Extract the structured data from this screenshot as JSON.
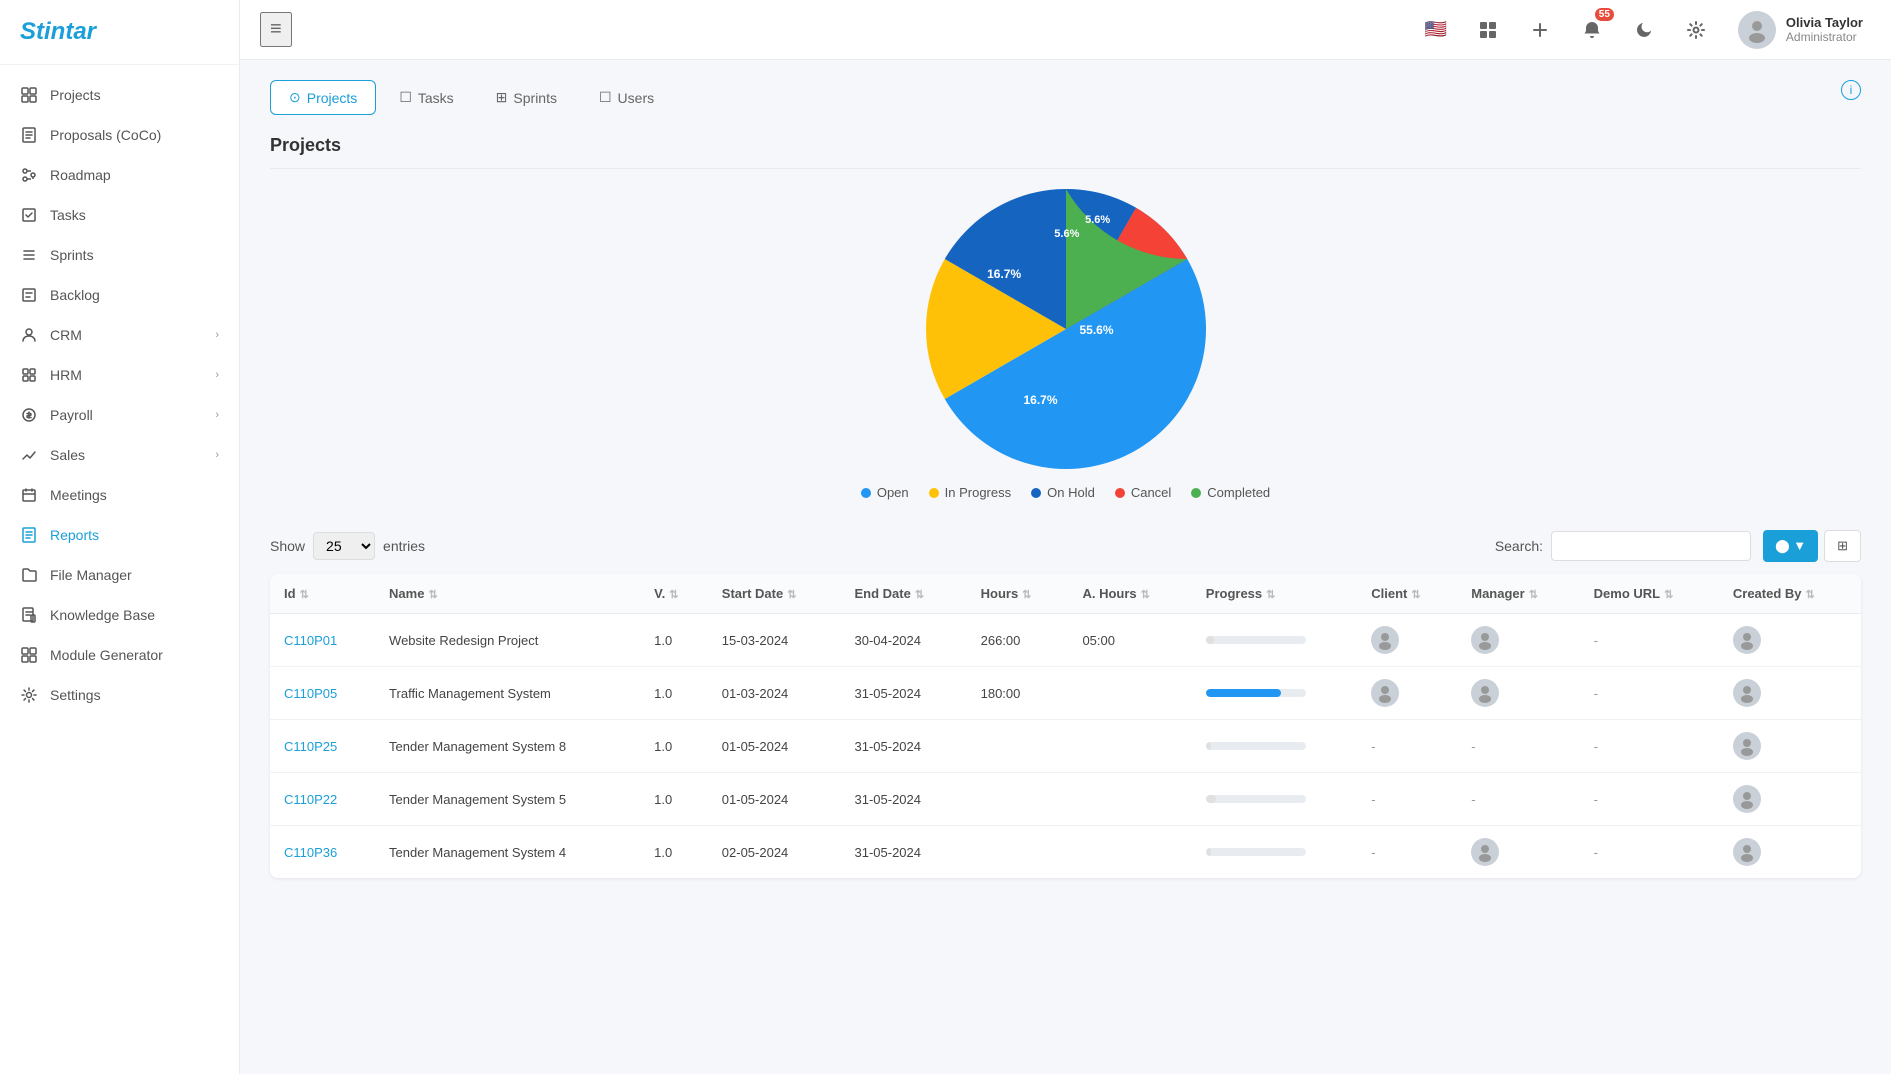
{
  "app": {
    "name": "Stintar"
  },
  "sidebar": {
    "items": [
      {
        "id": "projects",
        "label": "Projects",
        "icon": "folder-icon"
      },
      {
        "id": "proposals",
        "label": "Proposals (CoCo)",
        "icon": "document-icon"
      },
      {
        "id": "roadmap",
        "label": "Roadmap",
        "icon": "roadmap-icon"
      },
      {
        "id": "tasks",
        "label": "Tasks",
        "icon": "task-icon"
      },
      {
        "id": "sprints",
        "label": "Sprints",
        "icon": "sprints-icon"
      },
      {
        "id": "backlog",
        "label": "Backlog",
        "icon": "backlog-icon"
      },
      {
        "id": "crm",
        "label": "CRM",
        "icon": "crm-icon",
        "hasChildren": true
      },
      {
        "id": "hrm",
        "label": "HRM",
        "icon": "hrm-icon",
        "hasChildren": true
      },
      {
        "id": "payroll",
        "label": "Payroll",
        "icon": "payroll-icon",
        "hasChildren": true
      },
      {
        "id": "sales",
        "label": "Sales",
        "icon": "sales-icon",
        "hasChildren": true
      },
      {
        "id": "meetings",
        "label": "Meetings",
        "icon": "meetings-icon"
      },
      {
        "id": "reports",
        "label": "Reports",
        "icon": "reports-icon",
        "active": true
      },
      {
        "id": "file-manager",
        "label": "File Manager",
        "icon": "file-manager-icon"
      },
      {
        "id": "knowledge-base",
        "label": "Knowledge Base",
        "icon": "knowledge-icon"
      },
      {
        "id": "module-generator",
        "label": "Module Generator",
        "icon": "module-icon"
      },
      {
        "id": "settings",
        "label": "Settings",
        "icon": "settings-icon"
      }
    ]
  },
  "header": {
    "menu_icon": "≡",
    "notification_count": "55",
    "user": {
      "name": "Olivia Taylor",
      "role": "Administrator"
    }
  },
  "tabs": [
    {
      "id": "projects",
      "label": "Projects",
      "icon": "⊙",
      "active": true
    },
    {
      "id": "tasks",
      "label": "Tasks",
      "icon": "☐"
    },
    {
      "id": "sprints",
      "label": "Sprints",
      "icon": "⊞"
    },
    {
      "id": "users",
      "label": "Users",
      "icon": "☐"
    }
  ],
  "section": {
    "title": "Projects"
  },
  "chart": {
    "segments": [
      {
        "label": "Open",
        "value": 55.6,
        "color": "#2196F3",
        "startAngle": -90,
        "endAngle": 110
      },
      {
        "label": "In Progress",
        "value": 16.7,
        "color": "#FFC107",
        "startAngle": 110,
        "endAngle": 170
      },
      {
        "label": "On Hold",
        "value": 16.7,
        "color": "#1565C0",
        "startAngle": 170,
        "endAngle": 230
      },
      {
        "label": "Cancel",
        "value": 5.6,
        "color": "#F44336",
        "startAngle": 230,
        "endAngle": 250
      },
      {
        "label": "Completed",
        "value": 5.6,
        "color": "#4CAF50",
        "startAngle": 250,
        "endAngle": 270
      }
    ],
    "legend": [
      {
        "label": "Open",
        "color": "#2196F3"
      },
      {
        "label": "In Progress",
        "color": "#FFC107"
      },
      {
        "label": "On Hold",
        "color": "#1565C0"
      },
      {
        "label": "Cancel",
        "color": "#F44336"
      },
      {
        "label": "Completed",
        "color": "#4CAF50"
      }
    ]
  },
  "table": {
    "show_label": "Show",
    "entries_label": "entries",
    "show_value": "25",
    "search_label": "Search:",
    "search_placeholder": "",
    "columns": [
      {
        "key": "id",
        "label": "Id"
      },
      {
        "key": "name",
        "label": "Name"
      },
      {
        "key": "v",
        "label": "V."
      },
      {
        "key": "start_date",
        "label": "Start Date"
      },
      {
        "key": "end_date",
        "label": "End Date"
      },
      {
        "key": "hours",
        "label": "Hours"
      },
      {
        "key": "a_hours",
        "label": "A. Hours"
      },
      {
        "key": "progress",
        "label": "Progress"
      },
      {
        "key": "client",
        "label": "Client"
      },
      {
        "key": "manager",
        "label": "Manager"
      },
      {
        "key": "demo_url",
        "label": "Demo URL"
      },
      {
        "key": "created_by",
        "label": "Created By"
      }
    ],
    "rows": [
      {
        "id": "C110P01",
        "name": "Website Redesign Project",
        "v": "1.0",
        "start_date": "15-03-2024",
        "end_date": "30-04-2024",
        "hours": "266:00",
        "a_hours": "05:00",
        "progress": 8,
        "progress_color": "#e0e0e0",
        "has_client": true,
        "has_manager": true,
        "has_created": true
      },
      {
        "id": "C110P05",
        "name": "Traffic Management System",
        "v": "1.0",
        "start_date": "01-03-2024",
        "end_date": "31-05-2024",
        "hours": "180:00",
        "a_hours": "",
        "progress": 75,
        "progress_color": "#2196F3",
        "has_client": true,
        "has_manager": true,
        "has_created": true
      },
      {
        "id": "C110P25",
        "name": "Tender Management System 8",
        "v": "1.0",
        "start_date": "01-05-2024",
        "end_date": "31-05-2024",
        "hours": "",
        "a_hours": "",
        "progress": 5,
        "progress_color": "#e0e0e0",
        "has_client": false,
        "has_manager": false,
        "has_created": true
      },
      {
        "id": "C110P22",
        "name": "Tender Management System 5",
        "v": "1.0",
        "start_date": "01-05-2024",
        "end_date": "31-05-2024",
        "hours": "",
        "a_hours": "",
        "progress": 10,
        "progress_color": "#e0e0e0",
        "has_client": false,
        "has_manager": false,
        "has_created": true
      },
      {
        "id": "C110P36",
        "name": "Tender Management System 4",
        "v": "1.0",
        "start_date": "02-05-2024",
        "end_date": "31-05-2024",
        "hours": "",
        "a_hours": "",
        "progress": 5,
        "progress_color": "#e0e0e0",
        "has_client": false,
        "has_manager": true,
        "has_created": true
      }
    ]
  },
  "status_badge": {
    "in_progress": "In Progress"
  }
}
